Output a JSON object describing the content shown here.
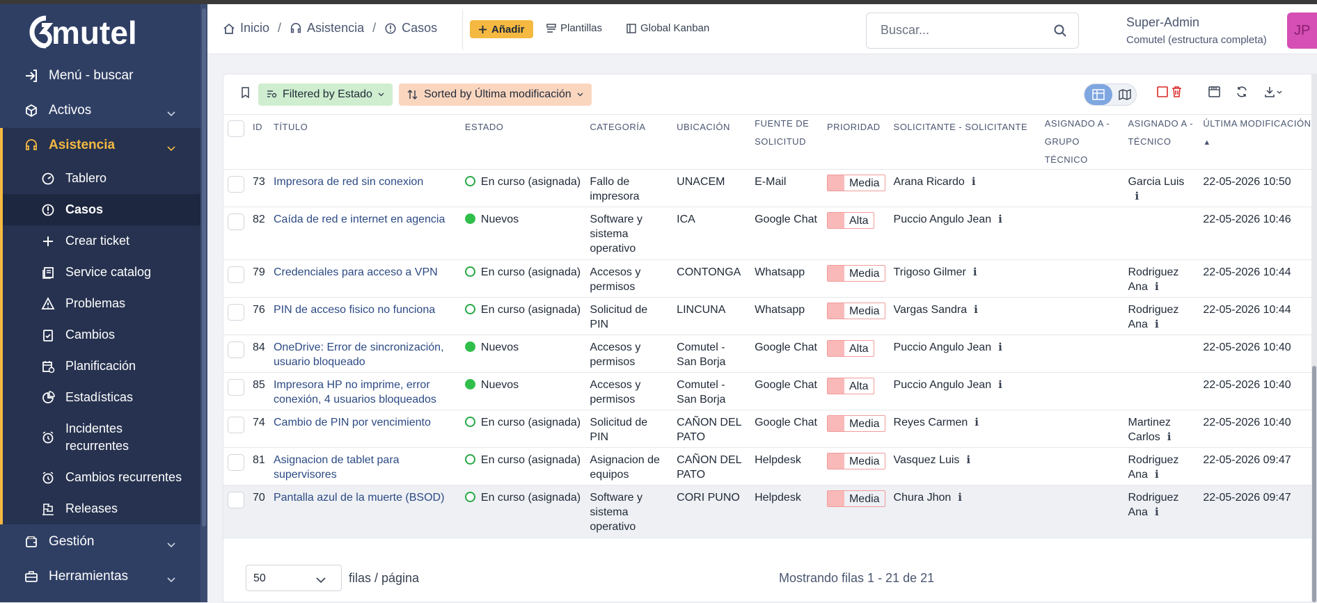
{
  "app": {
    "logo_text": "comutel"
  },
  "sidebar": {
    "items": [
      {
        "label": "Menú - buscar"
      },
      {
        "label": "Activos"
      },
      {
        "label": "Asistencia"
      },
      {
        "label": "Gestión"
      },
      {
        "label": "Herramientas"
      }
    ],
    "sub": [
      {
        "label": "Tablero"
      },
      {
        "label": "Casos"
      },
      {
        "label": "Crear ticket"
      },
      {
        "label": "Service catalog"
      },
      {
        "label": "Problemas"
      },
      {
        "label": "Cambios"
      },
      {
        "label": "Planificación"
      },
      {
        "label": "Estadísticas"
      },
      {
        "label": "Incidentes recurrentes"
      },
      {
        "label": "Cambios recurrentes"
      },
      {
        "label": "Releases"
      }
    ]
  },
  "header": {
    "crumbs": [
      "Inicio",
      "Asistencia",
      "Casos"
    ],
    "add_label": "Añadir",
    "templates_label": "Plantillas",
    "kanban_label": "Global Kanban",
    "search_placeholder": "Buscar...",
    "user_name": "Super-Admin",
    "user_entity": "Comutel (estructura completa)",
    "avatar": "JP"
  },
  "toolbar": {
    "filter_label": "Filtered by Estado",
    "sort_label": "Sorted by Última modificación"
  },
  "table": {
    "headers": [
      "ID",
      "TÍTULO",
      "ESTADO",
      "CATEGORÍA",
      "UBICACIÓN",
      "FUENTE DE SOLICITUD",
      "PRIORIDAD",
      "SOLICITANTE - SOLICITANTE",
      "ASIGNADO A - GRUPO TÉCNICO",
      "ASIGNADO A - TÉCNICO",
      "ÚLTIMA MODIFICACIÓN"
    ],
    "rows": [
      {
        "id": "73",
        "title": "Impresora de red sin conexion",
        "status": "En curso (asignada)",
        "status_type": "open",
        "category": "Fallo de impresora",
        "location": "UNACEM",
        "source": "E-Mail",
        "priority": "Media",
        "requester": "Arana Ricardo",
        "group": "",
        "tech": "Garcia Luis",
        "modified": "22-05-2026 10:50"
      },
      {
        "id": "82",
        "title": "Caída de red e internet en agencia",
        "status": "Nuevos",
        "status_type": "new",
        "category": "Software y sistema operativo",
        "location": "ICA",
        "source": "Google Chat",
        "priority": "Alta",
        "requester": "Puccio Angulo Jean",
        "group": "",
        "tech": "",
        "modified": "22-05-2026 10:46"
      },
      {
        "id": "79",
        "title": "Credenciales para acceso a VPN",
        "status": "En curso (asignada)",
        "status_type": "open",
        "category": "Accesos y permisos",
        "location": "CONTONGA",
        "source": "Whatsapp",
        "priority": "Media",
        "requester": "Trigoso Gilmer",
        "group": "",
        "tech": "Rodriguez Ana",
        "modified": "22-05-2026 10:44"
      },
      {
        "id": "76",
        "title": "PIN de acceso fisico no funciona",
        "status": "En curso (asignada)",
        "status_type": "open",
        "category": "Solicitud de PIN",
        "location": "LINCUNA",
        "source": "Whatsapp",
        "priority": "Media",
        "requester": "Vargas Sandra",
        "group": "",
        "tech": "Rodriguez Ana",
        "modified": "22-05-2026 10:44"
      },
      {
        "id": "84",
        "title": "OneDrive: Error de sincronización, usuario bloqueado",
        "status": "Nuevos",
        "status_type": "new",
        "category": "Accesos y permisos",
        "location": "Comutel - San Borja",
        "source": "Google Chat",
        "priority": "Alta",
        "requester": "Puccio Angulo Jean",
        "group": "",
        "tech": "",
        "modified": "22-05-2026 10:40"
      },
      {
        "id": "85",
        "title": "Impresora HP no imprime, error conexión, 4 usuarios bloqueados",
        "status": "Nuevos",
        "status_type": "new",
        "category": "Accesos y permisos",
        "location": "Comutel - San Borja",
        "source": "Google Chat",
        "priority": "Alta",
        "requester": "Puccio Angulo Jean",
        "group": "",
        "tech": "",
        "modified": "22-05-2026 10:40"
      },
      {
        "id": "74",
        "title": "Cambio de PIN por vencimiento",
        "status": "En curso (asignada)",
        "status_type": "open",
        "category": "Solicitud de PIN",
        "location": "CAÑON DEL PATO",
        "source": "Google Chat",
        "priority": "Media",
        "requester": "Reyes Carmen",
        "group": "",
        "tech": "Martinez Carlos",
        "modified": "22-05-2026 10:40"
      },
      {
        "id": "81",
        "title": "Asignacion de tablet para supervisores",
        "status": "En curso (asignada)",
        "status_type": "open",
        "category": "Asignacion de equipos",
        "location": "CAÑON DEL PATO",
        "source": "Helpdesk",
        "priority": "Media",
        "requester": "Vasquez Luis",
        "group": "",
        "tech": "Rodriguez Ana",
        "modified": "22-05-2026 09:47"
      },
      {
        "id": "70",
        "title": "Pantalla azul de la muerte (BSOD)",
        "status": "En curso (asignada)",
        "status_type": "open",
        "category": "Software y sistema operativo",
        "location": "CORI PUNO",
        "source": "Helpdesk",
        "priority": "Media",
        "requester": "Chura Jhon",
        "group": "",
        "tech": "Rodriguez Ana",
        "modified": "22-05-2026 09:47"
      }
    ]
  },
  "footer": {
    "per_page": "50",
    "per_page_label": "filas / página",
    "showing": "Mostrando filas 1 - 21 de 21"
  },
  "colors": {
    "sidebar": "#2f3f64",
    "accent": "#f5b942",
    "priority_high": "#f9b9b9"
  }
}
